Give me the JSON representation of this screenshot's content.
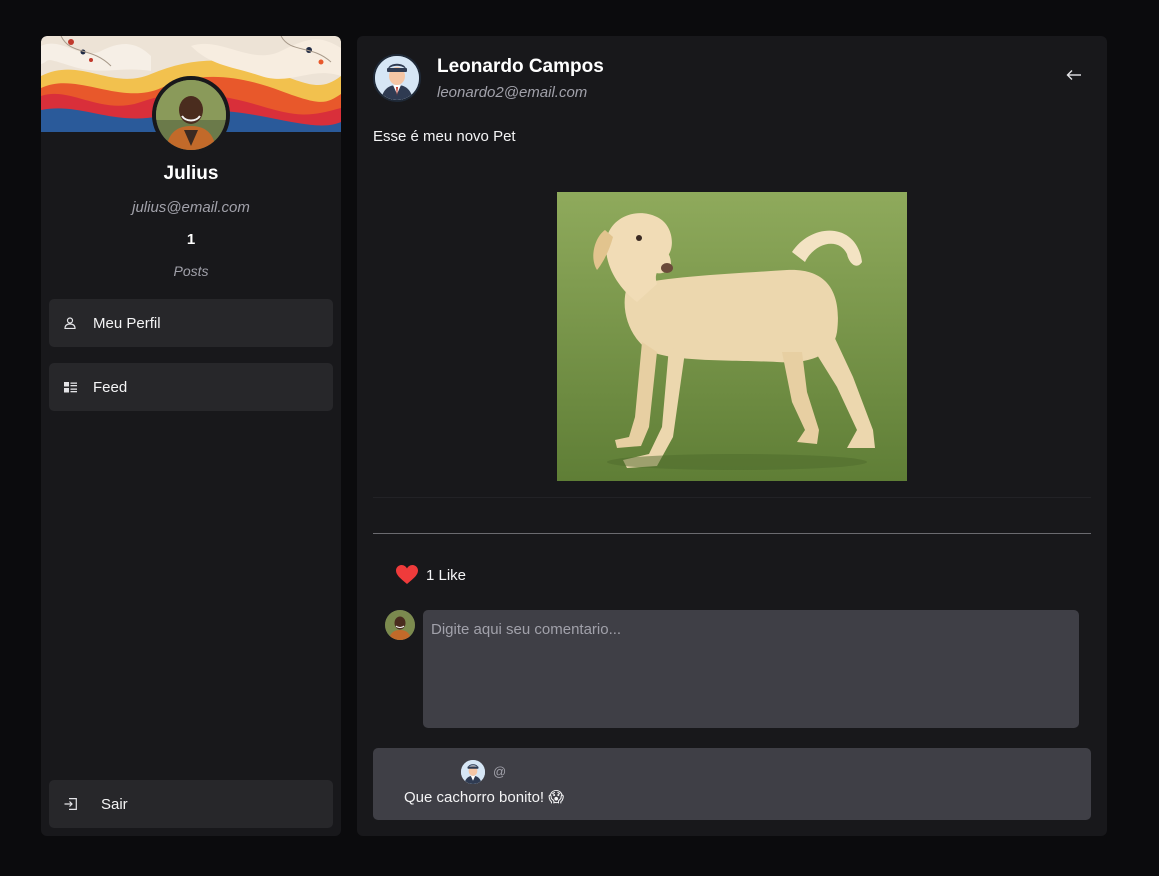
{
  "sidebar": {
    "user": {
      "name": "Julius",
      "email": "julius@email.com",
      "post_count": "1",
      "post_count_label": "Posts"
    },
    "nav": [
      {
        "label": "Meu Perfil",
        "icon": "user-icon"
      },
      {
        "label": "Feed",
        "icon": "feed-icon"
      }
    ],
    "logout": {
      "label": "Sair",
      "icon": "logout-icon"
    }
  },
  "post": {
    "author": {
      "name": "Leonardo Campos",
      "email": "leonardo2@email.com"
    },
    "back_icon": "arrow-left-icon",
    "text": "Esse é meu novo Pet",
    "image": "dog-photo",
    "likes": {
      "label": "1 Like",
      "icon": "heart-icon"
    },
    "comment_input": {
      "placeholder": "Digite aqui seu comentario...",
      "value": ""
    },
    "comments": [
      {
        "handle": "@",
        "text": "Que cachorro bonito! 😱"
      }
    ]
  },
  "colors": {
    "page_bg": "#0b0b0d",
    "panel_bg": "#18181b",
    "button_bg": "#27272a",
    "input_bg": "#3f3f46",
    "muted_text": "#a1a1aa",
    "like_red": "#ef3b3b"
  }
}
